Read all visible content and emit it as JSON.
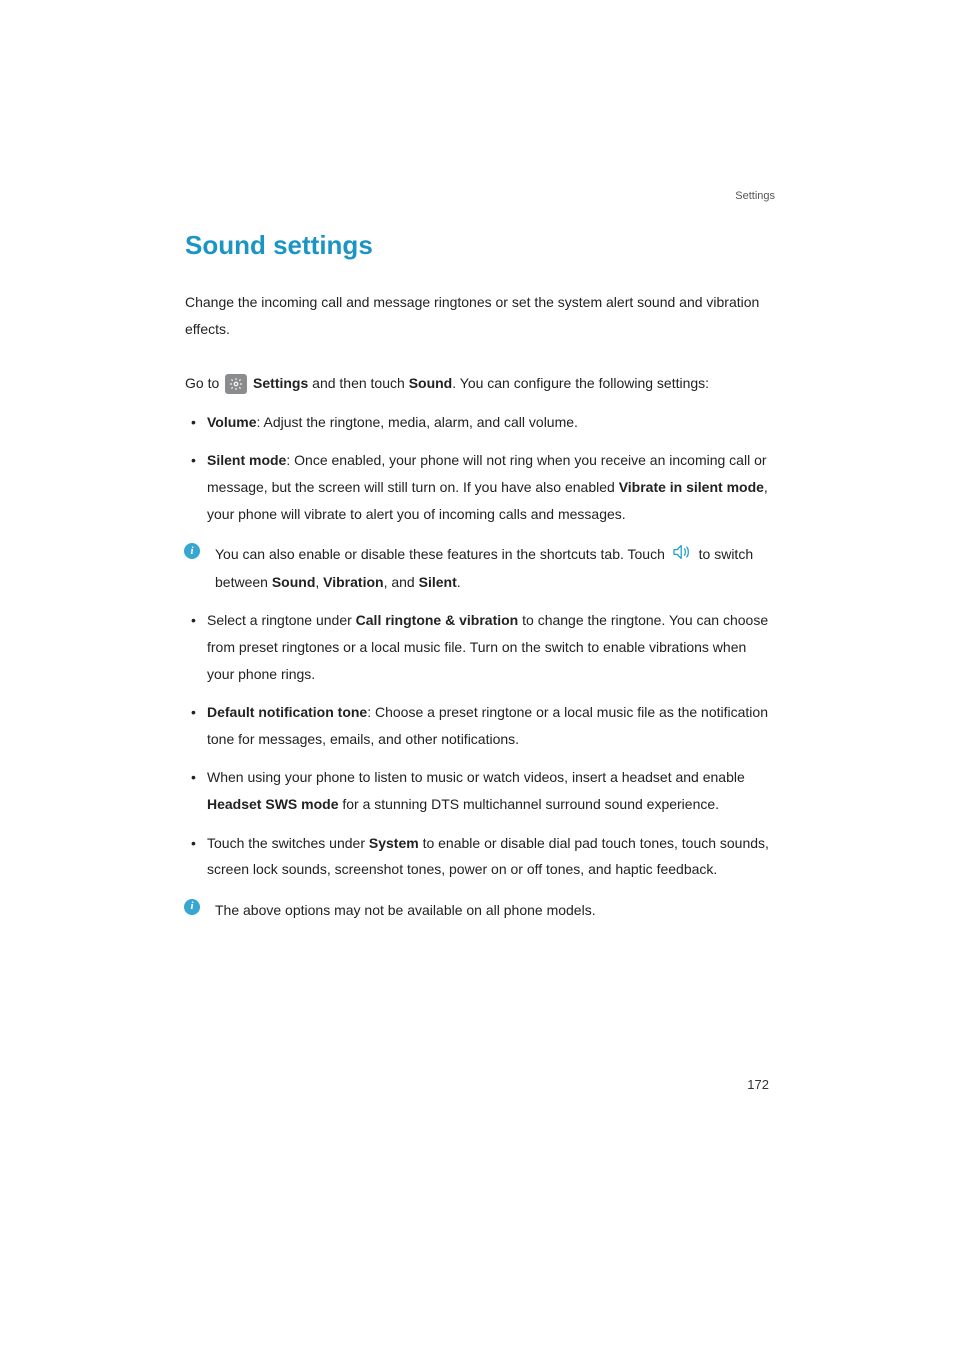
{
  "header": {
    "running": "Settings"
  },
  "title": "Sound settings",
  "intro": "Change the incoming call and message ringtones or set the system alert sound and vibration effects.",
  "goto": {
    "prefix": "Go to ",
    "settings_label": "Settings",
    "middle": " and then touch ",
    "sound_label": "Sound",
    "suffix": ". You can configure the following settings:"
  },
  "bullets1": {
    "b0": {
      "bold": "Volume",
      "rest": ": Adjust the ringtone, media, alarm, and call volume."
    },
    "b1": {
      "bold1": "Silent mode",
      "t1": ": Once enabled, your phone will not ring when you receive an incoming call or message, but the screen will still turn on. If you have also enabled ",
      "bold2": "Vibrate in silent mode",
      "t2": ", your phone will vibrate to alert you of incoming calls and messages."
    }
  },
  "info1": {
    "t1": "You can also enable or disable these features in the shortcuts tab. Touch ",
    "t2": " to switch between ",
    "b1": "Sound",
    "c1": ", ",
    "b2": "Vibration",
    "c2": ", and ",
    "b3": "Silent",
    "c3": "."
  },
  "bullets2": {
    "b0": {
      "t1": "Select a ringtone under ",
      "bold1": "Call ringtone & vibration",
      "t2": " to change the ringtone. You can choose from preset ringtones or a local music file. Turn on the switch to enable vibrations when your phone rings."
    },
    "b1": {
      "bold1": "Default notification tone",
      "t1": ": Choose a preset ringtone or a local music file as the notification tone for messages, emails, and other notifications."
    },
    "b2": {
      "t1": "When using your phone to listen to music or watch videos, insert a headset and enable ",
      "bold1": "Headset SWS mode",
      "t2": " for a stunning DTS multichannel surround sound experience."
    },
    "b3": {
      "t1": "Touch the switches under ",
      "bold1": "System",
      "t2": " to enable or disable dial pad touch tones, touch sounds, screen lock sounds, screenshot tones, power on or off tones, and haptic feedback."
    }
  },
  "info2": {
    "text": "The above options may not be available on all phone models."
  },
  "page_number": "172",
  "icons": {
    "info_glyph": "i"
  }
}
